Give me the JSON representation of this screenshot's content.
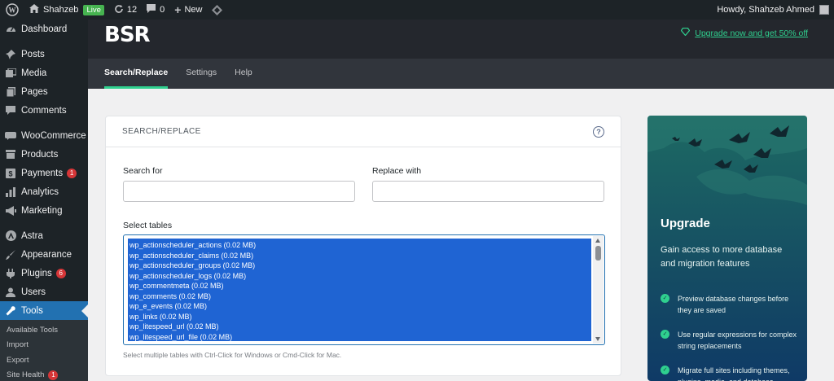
{
  "admin_bar": {
    "site_name": "Shahzeb",
    "live_badge": "Live",
    "updates_count": "12",
    "comments_count": "0",
    "new_label": "New",
    "howdy": "Howdy, Shahzeb Ahmed"
  },
  "sidebar": {
    "items": [
      {
        "label": "Dashboard",
        "icon": "dashboard-icon"
      },
      {
        "label": "Posts",
        "icon": "pin-icon"
      },
      {
        "label": "Media",
        "icon": "media-icon"
      },
      {
        "label": "Pages",
        "icon": "pages-icon"
      },
      {
        "label": "Comments",
        "icon": "comment-icon"
      },
      {
        "label": "WooCommerce",
        "icon": "woocommerce-icon"
      },
      {
        "label": "Products",
        "icon": "archive-icon"
      },
      {
        "label": "Payments",
        "icon": "payments-icon",
        "badge": "1"
      },
      {
        "label": "Analytics",
        "icon": "chart-icon"
      },
      {
        "label": "Marketing",
        "icon": "megaphone-icon"
      },
      {
        "label": "Astra",
        "icon": "astra-icon"
      },
      {
        "label": "Appearance",
        "icon": "brush-icon"
      },
      {
        "label": "Plugins",
        "icon": "plugin-icon",
        "badge": "6"
      },
      {
        "label": "Users",
        "icon": "user-icon"
      },
      {
        "label": "Tools",
        "icon": "wrench-icon"
      }
    ],
    "submenu": [
      {
        "label": "Available Tools"
      },
      {
        "label": "Import"
      },
      {
        "label": "Export"
      },
      {
        "label": "Site Health",
        "badge": "1"
      }
    ]
  },
  "header": {
    "logo": "BSR",
    "upgrade_link": "Upgrade now and get 50% off"
  },
  "tabs": [
    {
      "label": "Search/Replace"
    },
    {
      "label": "Settings"
    },
    {
      "label": "Help"
    }
  ],
  "card": {
    "title": "SEARCH/REPLACE",
    "help": "?",
    "search_label": "Search for",
    "search_value": "",
    "replace_label": "Replace with",
    "replace_value": "",
    "tables_label": "Select tables",
    "tables": [
      "wp_actionscheduler_actions (0.02 MB)",
      "wp_actionscheduler_claims (0.02 MB)",
      "wp_actionscheduler_groups (0.02 MB)",
      "wp_actionscheduler_logs (0.02 MB)",
      "wp_commentmeta (0.02 MB)",
      "wp_comments (0.02 MB)",
      "wp_e_events (0.02 MB)",
      "wp_links (0.02 MB)",
      "wp_litespeed_url (0.02 MB)",
      "wp_litespeed_url_file (0.02 MB)"
    ],
    "hint": "Select multiple tables with Ctrl-Click for Windows or Cmd-Click for Mac."
  },
  "promo": {
    "title": "Upgrade",
    "description": "Gain access to more database and migration features",
    "features": [
      "Preview database changes before they are saved",
      "Use regular expressions for complex string replacements",
      "Migrate full sites including themes, plugins, media, and database."
    ]
  },
  "colors": {
    "admin_dark": "#1d2327",
    "active_blue": "#2271b1",
    "accent_green": "#2fd08f",
    "selection_blue": "#1f64d3"
  }
}
